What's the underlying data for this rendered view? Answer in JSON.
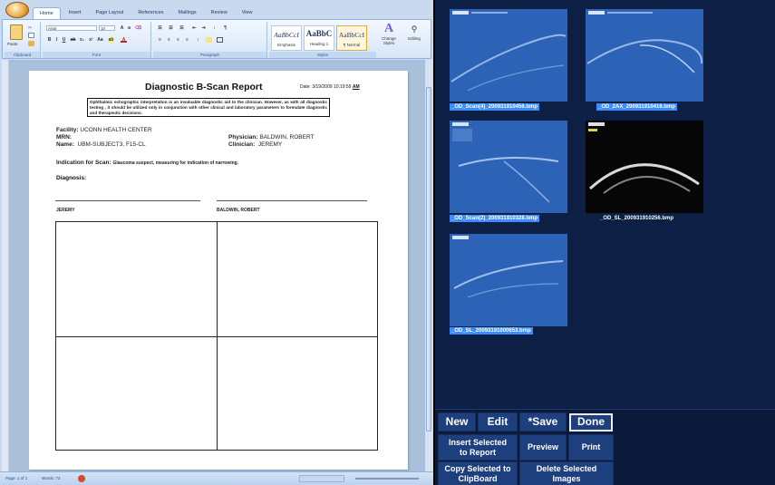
{
  "word": {
    "tabs": [
      "Home",
      "Insert",
      "Page Layout",
      "References",
      "Mailings",
      "Review",
      "View"
    ],
    "ribbon": {
      "font_name": "Arial",
      "font_size": "10",
      "groups": [
        "Clipboard",
        "Font",
        "Paragraph",
        "Styles"
      ],
      "paste_label": "Paste",
      "styles": [
        {
          "sample": "AaBbCcI",
          "name": "Emphasis"
        },
        {
          "sample": "AaBbC",
          "name": "Heading 1"
        },
        {
          "sample": "AaBbCcI",
          "name": "¶ Normal"
        }
      ],
      "change_styles": "Change Styles",
      "editing": "Editing"
    },
    "status": {
      "page": "Page: 1 of 1",
      "words": "Words: 73"
    }
  },
  "report": {
    "title": "Diagnostic B-Scan Report",
    "date_label": "Date:",
    "date_value": "3/19/2009 10:19:59",
    "date_suffix": "AM",
    "disclaimer": "Ophthalmic echographic interpretation is an invaluable diagnostic aid to the clinician. However, as with all diagnostic testing , it should be utilized only in conjunction with other clinical and laboratory parameters to formulate diagnostic and therapeutic decisions.",
    "facility_label": "Facility:",
    "facility_value": "UCONN HEALTH CENTER",
    "mrn_label": "MRN:",
    "mrn_value": "",
    "name_label": "Name:",
    "name_value": "UBM-SUBJECT3, F15-CL",
    "physician_label": "Physician:",
    "physician_value": "BALDWIN, ROBERT",
    "clinician_label": "Clinician:",
    "clinician_value": "JEREMY",
    "indication_label": "Indication for Scan:",
    "indication_value": "Glaucoma suspect, measuring for indication of narrowing.",
    "diagnosis_label": "Diagnosis:",
    "sig_left": "JEREMY",
    "sig_right": "BALDWIN, ROBERT"
  },
  "images": [
    {
      "caption": "_OD_Scan(4)_200931910456.bmp",
      "selected": true
    },
    {
      "caption": "_OD_2AX_200931910416.bmp",
      "selected": true
    },
    {
      "caption": "_OD_Scan(2)_200931910328.bmp",
      "selected": true
    },
    {
      "caption": "_OD_SL_200931910256.bmp",
      "selected": false
    },
    {
      "caption": "_OD_SL_20093191000653.bmp",
      "selected": true
    }
  ],
  "buttons": {
    "new": "New",
    "edit": "Edit",
    "save": "*Save",
    "done": "Done",
    "insert_selected": "Insert Selected to Report",
    "preview": "Preview",
    "print": "Print",
    "copy_selected": "Copy Selected to ClipBoard",
    "delete_selected": "Delete Selected Images"
  }
}
